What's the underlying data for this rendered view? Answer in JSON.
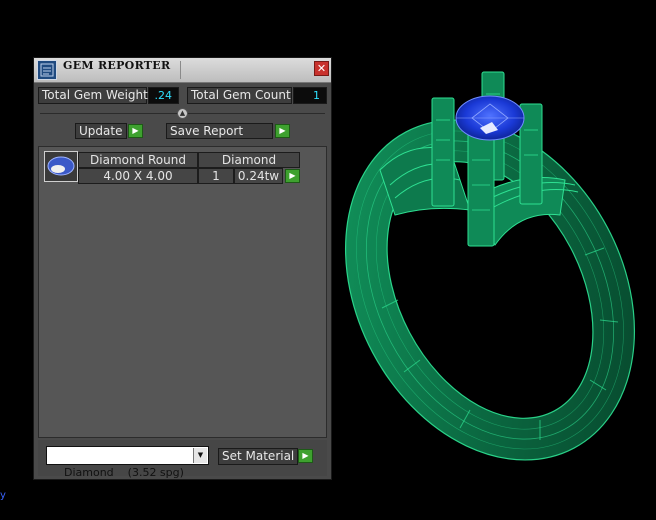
{
  "window": {
    "title": "GEM REPORTER",
    "close_glyph": "✕"
  },
  "summary": {
    "weight_label": "Total Gem Weight",
    "weight_value": ".24",
    "count_label": "Total Gem Count",
    "count_value": "1"
  },
  "toolbar": {
    "update_label": "Update",
    "save_report_label": "Save Report",
    "arrow_glyph": "▶",
    "collapse_glyph": "▲"
  },
  "gems": [
    {
      "shape": "Diamond Round",
      "material": "Diamond",
      "size": "4.00 X 4.00",
      "count": "1",
      "weight": "0.24tw"
    }
  ],
  "material_select": {
    "value": "Diamond    (3.52 spg)",
    "arrow_glyph": "▼"
  },
  "set_material_label": "Set Material",
  "corner_mark": "y",
  "icons": {
    "app": "gem-reporter-app-icon",
    "thumb": "round-diamond-thumbnail-icon",
    "close": "close-icon"
  },
  "colors": {
    "ring_body": "#0e7a4e",
    "ring_edge": "#2ee092",
    "gem": "#1a39d6",
    "value_text": "#2ee0ff",
    "play_button": "#3ea12f",
    "close_button": "#c8322d"
  }
}
